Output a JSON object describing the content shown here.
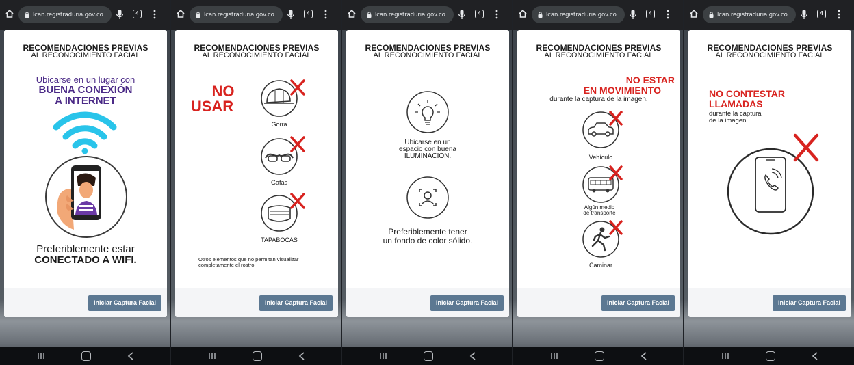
{
  "browser": {
    "url": "lcan.registraduria.gov.co",
    "tabs_count": "4"
  },
  "card_title": {
    "line1": "RECOMENDACIONES PREVIAS",
    "line2": "AL RECONOCIMIENTO FACIAL"
  },
  "cta_label": "Iniciar Captura Facial",
  "screen1": {
    "line1": "Ubicarse en un lugar con",
    "line2": "BUENA CONEXIÓN",
    "line3": "A INTERNET",
    "bottom1": "Preferiblemente estar",
    "bottom2": "CONECTADO A WIFI."
  },
  "screen2": {
    "no": "NO",
    "usar": "USAR",
    "items": [
      "Gorra",
      "Gafas",
      "TAPABOCAS"
    ],
    "note": "Otros elementos que no permitan visualizar completamente el rostro."
  },
  "screen3": {
    "light_1": "Ubicarse en un",
    "light_2": "espacio con buena",
    "light_3": "ILUMINACIÓN.",
    "bg_1": "Preferiblemente tener",
    "bg_2": "un fondo de color sólido."
  },
  "screen4": {
    "heading1": "NO ESTAR",
    "heading2": "EN MOVIMIENTO",
    "subtitle": "durante la captura de la imagen.",
    "items": [
      "Vehículo",
      "Algún medio",
      "de transporte",
      "Caminar"
    ]
  },
  "screen5": {
    "heading1": "NO CONTESTAR",
    "heading2": "LLAMADAS",
    "sub1": "durante la captura",
    "sub2": "de la imagen."
  },
  "colors": {
    "purple": "#4b2a87",
    "red": "#d8231f",
    "wifi": "#29c4ea",
    "button": "#5c7892"
  }
}
